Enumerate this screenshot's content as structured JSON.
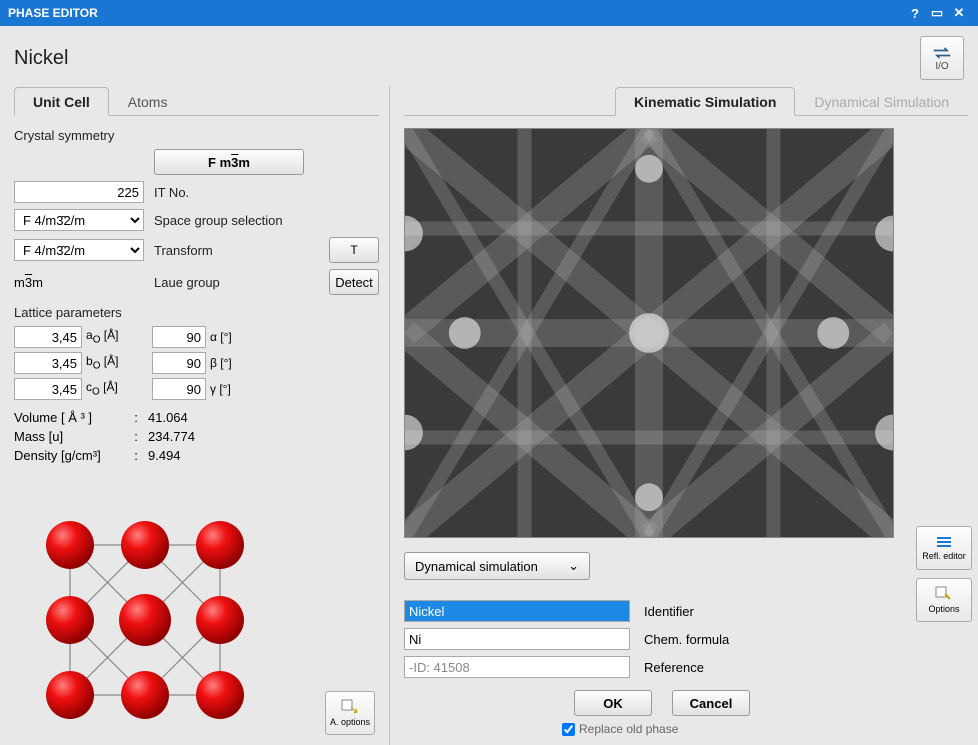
{
  "window": {
    "title": "PHASE EDITOR"
  },
  "header": {
    "phase_name": "Nickel",
    "io_label": "I/O"
  },
  "left_tabs": {
    "unit_cell": "Unit Cell",
    "atoms": "Atoms"
  },
  "symmetry": {
    "heading": "Crystal symmetry",
    "main_button": "F m3̄m",
    "it_value": "225",
    "it_label": "IT No.",
    "space_group_value": "F 4/m3̄2/m",
    "space_group_label": "Space group selection",
    "transform_value": "F 4/m3̄2/m",
    "transform_label": "Transform",
    "t_button": "T",
    "laue_value": "m3̄m",
    "laue_label": "Laue group",
    "detect_button": "Detect"
  },
  "lattice": {
    "heading": "Lattice parameters",
    "a": "3,45",
    "a_label": "aₒ [Å]",
    "b": "3,45",
    "b_label": "bₒ [Å]",
    "c": "3,45",
    "c_label": "cₒ [Å]",
    "alpha": "90",
    "alpha_label": "α [°]",
    "beta": "90",
    "beta_label": "β [°]",
    "gamma": "90",
    "gamma_label": "γ [°]"
  },
  "properties": {
    "volume_label": "Volume [ Å ³ ]",
    "volume": "41.064",
    "mass_label": "Mass [u]",
    "mass": "234.774",
    "density_label": "Density [g/cm³]",
    "density": "9.494"
  },
  "atom_options": "A. options",
  "right_tabs": {
    "kinematic": "Kinematic Simulation",
    "dynamical": "Dynamical Simulation"
  },
  "side": {
    "refl_editor": "Refl. editor",
    "options": "Options"
  },
  "sim_button": "Dynamical simulation",
  "form": {
    "identifier_value": "Nickel",
    "identifier_label": "Identifier",
    "formula_value": "Ni",
    "formula_label": "Chem. formula",
    "reference_value": "-ID: 41508",
    "reference_label": "Reference"
  },
  "actions": {
    "ok": "OK",
    "cancel": "Cancel",
    "replace": "Replace old phase"
  }
}
